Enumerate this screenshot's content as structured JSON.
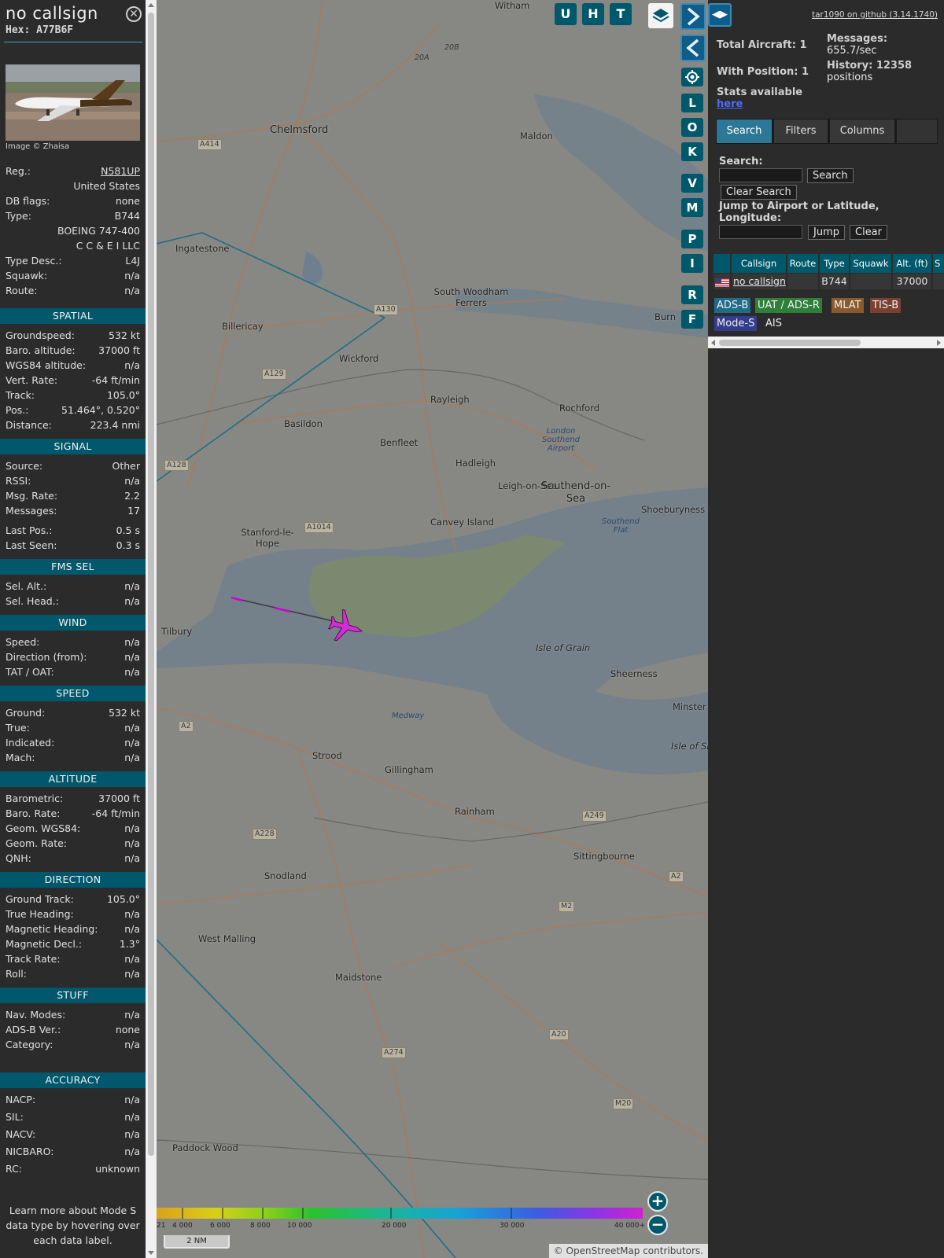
{
  "info": {
    "callsign": "no callsign",
    "hex": "Hex: A77B6F",
    "image_credit": "Image © Zhaisa",
    "rows_basic": [
      {
        "k": "Reg.:",
        "v": "N581UP",
        "link": true
      },
      {
        "k": "",
        "v": "United States"
      },
      {
        "k": "DB flags:",
        "v": "none"
      },
      {
        "k": "Type:",
        "v": "B744"
      },
      {
        "k": "",
        "v": "BOEING 747-400"
      },
      {
        "k": "",
        "v": "C C & E I LLC"
      },
      {
        "k": "Type Desc.:",
        "v": "L4J"
      },
      {
        "k": "Squawk:",
        "v": "n/a"
      },
      {
        "k": "Route:",
        "v": "n/a"
      }
    ],
    "sections": [
      {
        "title": "SPATIAL",
        "rows": [
          {
            "k": "Groundspeed:",
            "v": "532 kt"
          },
          {
            "k": "Baro. altitude:",
            "v": "37000 ft"
          },
          {
            "k": "WGS84 altitude:",
            "v": "n/a"
          },
          {
            "k": "Vert. Rate:",
            "v": "-64 ft/min"
          },
          {
            "k": "Track:",
            "v": "105.0°"
          },
          {
            "k": "Pos.:",
            "v": "51.464°, 0.520°"
          },
          {
            "k": "Distance:",
            "v": "223.4 nmi"
          }
        ]
      },
      {
        "title": "SIGNAL",
        "rows": [
          {
            "k": "Source:",
            "v": "Other"
          },
          {
            "k": "RSSI:",
            "v": "n/a"
          },
          {
            "k": "Msg. Rate:",
            "v": "2.2"
          },
          {
            "k": "Messages:",
            "v": "17"
          },
          {
            "k": "Last Pos.:",
            "v": "0.5 s"
          },
          {
            "k": "Last Seen:",
            "v": "0.3 s"
          }
        ]
      },
      {
        "title": "FMS SEL",
        "rows": [
          {
            "k": "Sel. Alt.:",
            "v": "n/a"
          },
          {
            "k": "Sel. Head.:",
            "v": "n/a"
          }
        ]
      },
      {
        "title": "WIND",
        "rows": [
          {
            "k": "Speed:",
            "v": "n/a"
          },
          {
            "k": "Direction (from):",
            "v": "n/a"
          },
          {
            "k": "TAT / OAT:",
            "v": "n/a"
          }
        ]
      },
      {
        "title": "SPEED",
        "rows": [
          {
            "k": "Ground:",
            "v": "532 kt"
          },
          {
            "k": "True:",
            "v": "n/a"
          },
          {
            "k": "Indicated:",
            "v": "n/a"
          },
          {
            "k": "Mach:",
            "v": "n/a"
          }
        ]
      },
      {
        "title": "ALTITUDE",
        "rows": [
          {
            "k": "Barometric:",
            "v": "37000 ft"
          },
          {
            "k": "Baro. Rate:",
            "v": "-64 ft/min"
          },
          {
            "k": "Geom. WGS84:",
            "v": "n/a"
          },
          {
            "k": "Geom. Rate:",
            "v": "n/a"
          },
          {
            "k": "QNH:",
            "v": "n/a"
          }
        ]
      },
      {
        "title": "DIRECTION",
        "rows": [
          {
            "k": "Ground Track:",
            "v": "105.0°"
          },
          {
            "k": "True Heading:",
            "v": "n/a"
          },
          {
            "k": "Magnetic Heading:",
            "v": "n/a"
          },
          {
            "k": "Magnetic Decl.:",
            "v": "1.3°"
          },
          {
            "k": "Track Rate:",
            "v": "n/a"
          },
          {
            "k": "Roll:",
            "v": "n/a"
          }
        ]
      },
      {
        "title": "STUFF",
        "rows": [
          {
            "k": "Nav. Modes:",
            "v": "n/a"
          },
          {
            "k": "ADS-B Ver.:",
            "v": "none"
          },
          {
            "k": "Category:",
            "v": "n/a"
          }
        ]
      },
      {
        "title": "ACCURACY",
        "rows": [
          {
            "k": "NACP:",
            "v": "n/a"
          },
          {
            "k": "SIL:",
            "v": "n/a"
          },
          {
            "k": "NACV:",
            "v": "n/a"
          },
          {
            "k": "NICBARO:",
            "v": "n/a"
          },
          {
            "k": "RC:",
            "v": "unknown"
          }
        ]
      }
    ],
    "note": "Learn more about Mode S data type by hovering over each data label."
  },
  "map": {
    "places": [
      {
        "name": "Witham",
        "big": false
      },
      {
        "name": "Chelmsford",
        "big": true
      },
      {
        "name": "Maldon",
        "big": false
      },
      {
        "name": "Ingatestone",
        "big": false
      },
      {
        "name": "South Woodham Ferrers",
        "big": false
      },
      {
        "name": "Billericay",
        "big": false
      },
      {
        "name": "Wickford",
        "big": false
      },
      {
        "name": "Rayleigh",
        "big": false
      },
      {
        "name": "Rochford",
        "big": false
      },
      {
        "name": "Basildon",
        "big": false
      },
      {
        "name": "Benfleet",
        "big": false
      },
      {
        "name": "Hadleigh",
        "big": false
      },
      {
        "name": "Leigh-on-Sea",
        "big": false
      },
      {
        "name": "Southend-on-Sea",
        "big": true
      },
      {
        "name": "Shoeburyness",
        "big": false
      },
      {
        "name": "Canvey Island",
        "big": false
      },
      {
        "name": "Stanford-le-Hope",
        "big": false
      },
      {
        "name": "Tilbury",
        "big": false
      },
      {
        "name": "Isle of Grain",
        "big": false
      },
      {
        "name": "Sheerness",
        "big": false
      },
      {
        "name": "Minster",
        "big": false
      },
      {
        "name": "Isle of Sh",
        "big": false
      },
      {
        "name": "Strood",
        "big": false
      },
      {
        "name": "Gillingham",
        "big": false
      },
      {
        "name": "Rainham",
        "big": false
      },
      {
        "name": "Snodland",
        "big": false
      },
      {
        "name": "Sittingbourne",
        "big": false
      },
      {
        "name": "West Malling",
        "big": false
      },
      {
        "name": "Maidstone",
        "big": false
      },
      {
        "name": "Paddock Wood",
        "big": false
      },
      {
        "name": "Burn",
        "big": false
      }
    ],
    "water_labels": [
      "London Southend Airport",
      "Southend Flat",
      "Medway"
    ],
    "roads": [
      "A414",
      "A130",
      "A129",
      "A128",
      "A1014",
      "A2",
      "A228",
      "A249",
      "A2",
      "M2",
      "A274",
      "A20",
      "M20",
      "20A",
      "20B"
    ],
    "buttons": [
      "U",
      "H",
      "T",
      "L",
      "O",
      "K",
      "V",
      "M",
      "P",
      "I",
      "R",
      "F"
    ],
    "altitude_ticks": [
      "21",
      "4 000",
      "6 000",
      "8 000",
      "10 000",
      "20 000",
      "30 000",
      "40 000+"
    ],
    "scale": "2 NM",
    "attribution": "© OpenStreetMap contributors."
  },
  "side": {
    "version": "tar1090 on github (3.14.1740)",
    "total_aircraft": "Total Aircraft: 1",
    "with_position": "With Position: 1",
    "messages_label": "Messages:",
    "messages_value": "655.7/sec",
    "history_label": "History: 12358",
    "history_value": "positions",
    "stats_label": "Stats available",
    "stats_link": "here",
    "tabs": [
      "Search",
      "Filters",
      "Columns"
    ],
    "search_label": "Search:",
    "search_button": "Search",
    "clear_search_button": "Clear Search",
    "jump_label": "Jump to Airport or Latitude, Longitude:",
    "jump_button": "Jump",
    "clear_button": "Clear",
    "table_headers": [
      "Callsign",
      "Route",
      "Type",
      "Squawk",
      "Alt. (ft)",
      "S"
    ],
    "table_row": {
      "callsign": "no callsign",
      "route": "",
      "type": "B744",
      "squawk": "",
      "alt": "37000"
    },
    "badges": [
      "ADS-B",
      "UAT / ADS-R",
      "MLAT",
      "TIS-B",
      "Mode-S",
      "AIS"
    ],
    "colors": {
      "adsb": "#1f6b8a",
      "uat": "#2e7f3a",
      "mlat": "#8a5a2e",
      "tisb": "#7a4030",
      "modes": "#343d8c",
      "header": "#00596b",
      "active_tab": "#2d7896"
    }
  }
}
